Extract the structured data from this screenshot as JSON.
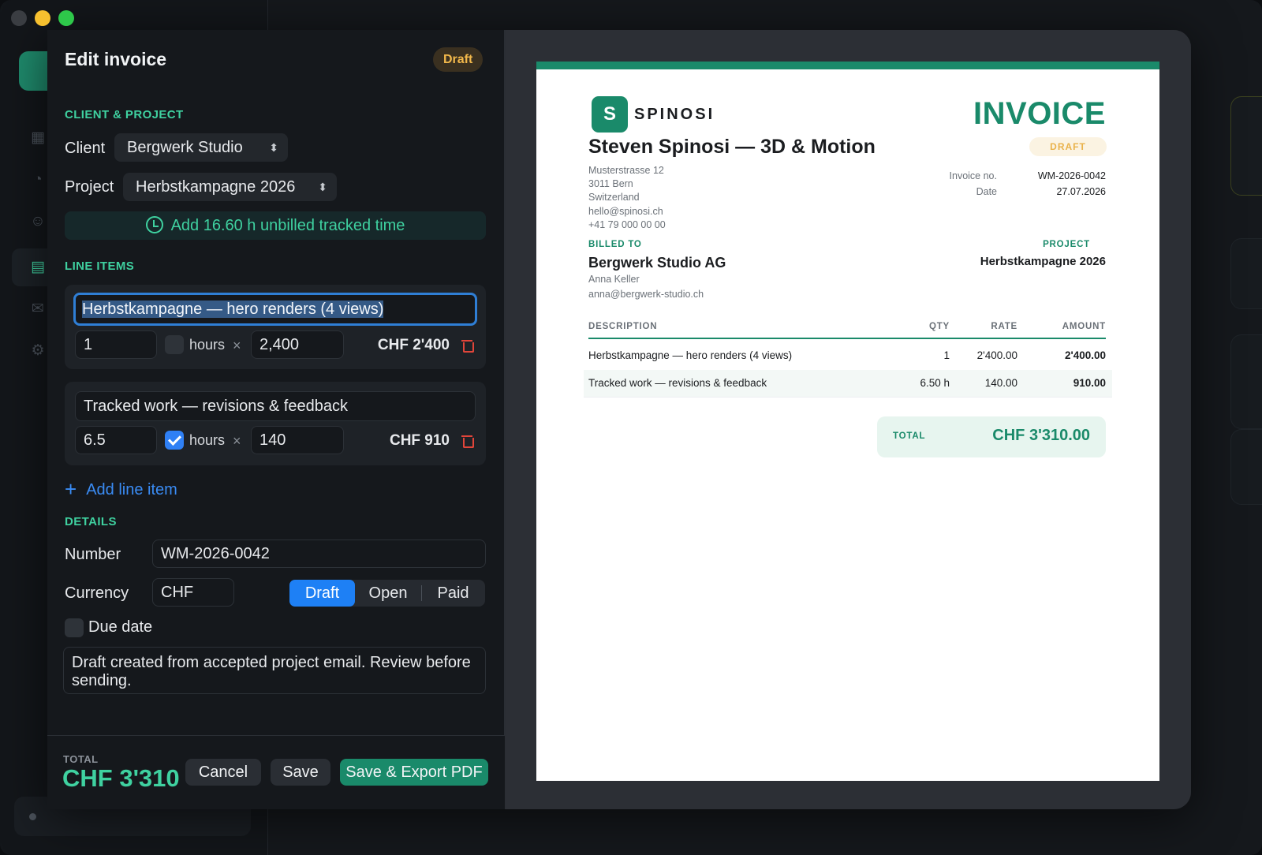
{
  "colors": {
    "accent": "#3fd1a0",
    "brand": "#1a8a6a",
    "primary_blue": "#1e80f5",
    "draft": "#f2b84b",
    "danger": "#e0453a"
  },
  "editor": {
    "title": "Edit invoice",
    "status_badge": "Draft",
    "client_section": "CLIENT & PROJECT",
    "client_label": "Client",
    "client_value": "Bergwerk Studio",
    "project_label": "Project",
    "project_value": "Herbstkampagne 2026",
    "add_time_label": "Add 16.60 h unbilled tracked time",
    "line_items_section": "LINE ITEMS",
    "line_items": [
      {
        "description": "Herbstkampagne — hero renders (4 views)",
        "qty": "1",
        "hours_checked": false,
        "hours_label": "hours",
        "times": "×",
        "rate": "2,400",
        "amount": "CHF 2'400"
      },
      {
        "description": "Tracked work — revisions & feedback",
        "qty": "6.5",
        "hours_checked": true,
        "hours_label": "hours",
        "times": "×",
        "rate": "140",
        "amount": "CHF 910"
      }
    ],
    "add_line_label": "Add line item",
    "details_section": "DETAILS",
    "number_label": "Number",
    "number_value": "WM-2026-0042",
    "currency_label": "Currency",
    "currency_value": "CHF",
    "status_options": [
      "Draft",
      "Open",
      "Paid"
    ],
    "status_selected": "Draft",
    "due_date_label": "Due date",
    "notes": "Draft created from accepted project email. Review before sending.",
    "footer": {
      "total_label": "TOTAL",
      "total_value": "CHF 3'310",
      "cancel": "Cancel",
      "save": "Save",
      "export": "Save & Export PDF"
    }
  },
  "invoice": {
    "logo_letter": "S",
    "brand": "SPINOSI",
    "heading": "INVOICE",
    "status": "DRAFT",
    "sender_name": "Steven Spinosi — 3D & Motion",
    "sender_address": [
      "Musterstrasse 12",
      "3011 Bern",
      "Switzerland",
      "hello@spinosi.ch",
      "+41 79 000 00 00"
    ],
    "invoice_no_label": "Invoice no.",
    "invoice_no": "WM-2026-0042",
    "date_label": "Date",
    "date": "27.07.2026",
    "billed_to_label": "BILLED TO",
    "client_name": "Bergwerk Studio AG",
    "client_contact": "Anna Keller",
    "client_email": "anna@bergwerk-studio.ch",
    "project_label": "PROJECT",
    "project_name": "Herbstkampagne 2026",
    "columns": [
      "DESCRIPTION",
      "QTY",
      "RATE",
      "AMOUNT"
    ],
    "rows": [
      {
        "description": "Herbstkampagne — hero renders (4 views)",
        "qty": "1",
        "rate": "2'400.00",
        "amount": "2'400.00"
      },
      {
        "description": "Tracked work — revisions & feedback",
        "qty": "6.50 h",
        "rate": "140.00",
        "amount": "910.00"
      }
    ],
    "total_label": "TOTAL",
    "total_value": "CHF 3'310.00"
  }
}
